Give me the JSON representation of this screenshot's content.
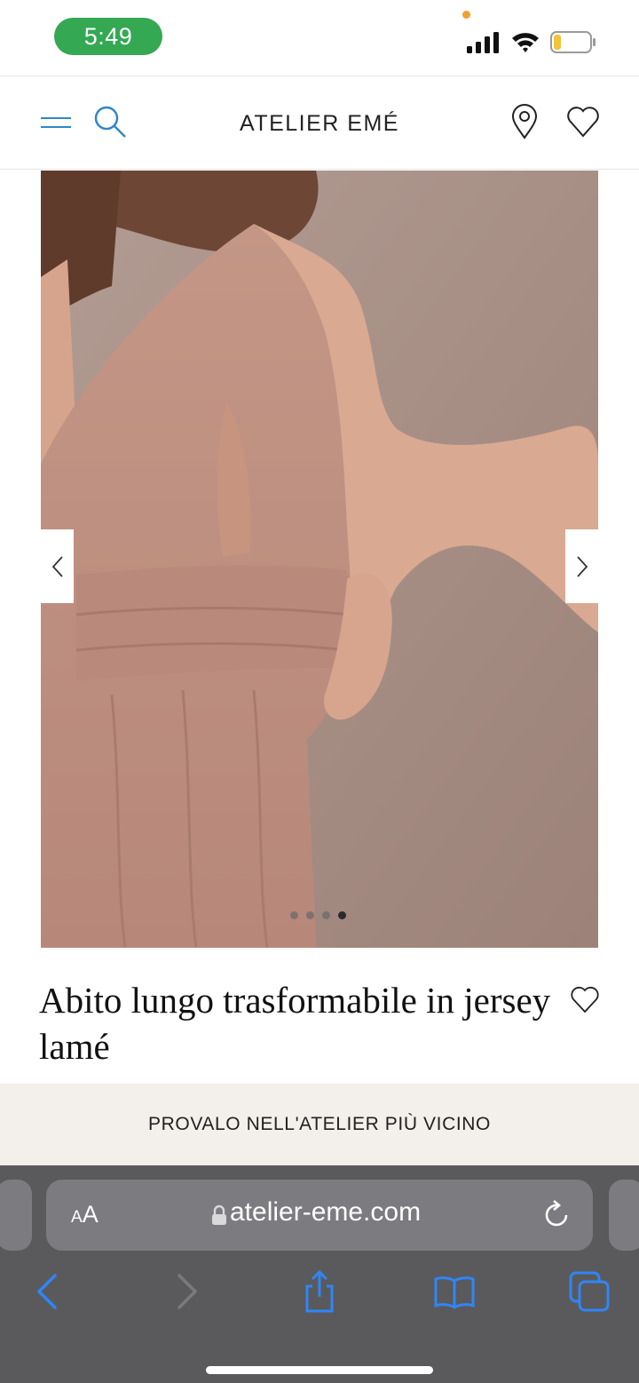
{
  "status_bar": {
    "time": "5:49",
    "colors": {
      "time_pill": "#34a853",
      "dot": "#f0a030"
    },
    "icons": [
      "signal-icon",
      "wifi-icon",
      "battery-icon"
    ]
  },
  "header": {
    "brand": "ATELIER EMÉ",
    "icons": [
      "menu-icon",
      "search-icon",
      "location-icon",
      "wishlist-icon"
    ],
    "accent_color": "#2f86c8"
  },
  "gallery": {
    "image_count": 4,
    "active_index": 3,
    "icons": [
      "chevron-left-icon",
      "chevron-right-icon"
    ]
  },
  "product": {
    "title": "Abito lungo trasformabile in jersey lamé"
  },
  "cta": {
    "label": "PROVALO NELL'ATELIER PIÙ VICINO"
  },
  "browser": {
    "aa_label_small": "A",
    "aa_label_large": "A",
    "url": "atelier-eme.com",
    "icons": [
      "lock-icon",
      "reload-icon",
      "back-icon",
      "forward-icon",
      "share-icon",
      "bookmarks-icon",
      "tabs-icon"
    ],
    "accent_color": "#2f86f6"
  }
}
